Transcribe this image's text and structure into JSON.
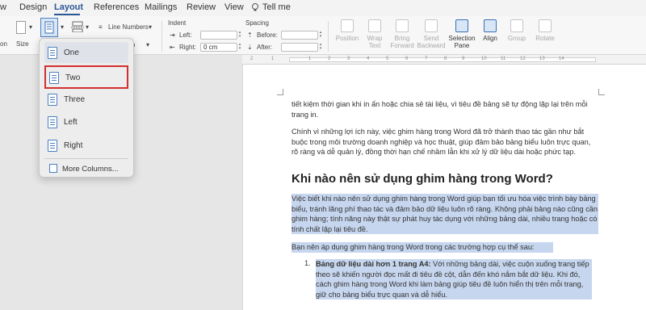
{
  "tabs": [
    {
      "label": "w",
      "active": false
    },
    {
      "label": "Design",
      "active": false
    },
    {
      "label": "Layout",
      "active": true
    },
    {
      "label": "References",
      "active": false
    },
    {
      "label": "Mailings",
      "active": false
    },
    {
      "label": "Review",
      "active": false
    },
    {
      "label": "View",
      "active": false
    }
  ],
  "tell_me": "Tell me",
  "ribbon": {
    "size_label": "Size",
    "on_label": "on",
    "line_numbers": "Line Numbers",
    "hyphenation": "ation",
    "indent": {
      "title": "Indent",
      "left_label": "Left:",
      "right_label": "Right:",
      "left_value": "",
      "right_value": "0 cm"
    },
    "spacing": {
      "title": "Spacing",
      "before_label": "Before:",
      "after_label": "After:",
      "before_value": "",
      "after_value": ""
    },
    "arrange": [
      {
        "label": "Position",
        "enabled": false
      },
      {
        "label": "Wrap\nText",
        "enabled": false
      },
      {
        "label": "Bring\nForward",
        "enabled": false
      },
      {
        "label": "Send\nBackward",
        "enabled": false
      },
      {
        "label": "Selection\nPane",
        "enabled": true
      },
      {
        "label": "Align",
        "enabled": true
      },
      {
        "label": "Group",
        "enabled": false
      },
      {
        "label": "Rotate",
        "enabled": false
      }
    ]
  },
  "ruler": {
    "ticks": [
      "2",
      "1",
      "1",
      "2",
      "3",
      "4",
      "5",
      "6",
      "7",
      "8",
      "9",
      "10",
      "11",
      "12",
      "13",
      "14"
    ]
  },
  "columns_menu": {
    "items": [
      "One",
      "Two",
      "Three",
      "Left",
      "Right"
    ],
    "more": "More Columns...",
    "highlighted": "Two"
  },
  "document": {
    "p1": "tiết kiệm thời gian khi in ấn hoặc chia sẻ tài liệu, vì tiêu đề bảng sẽ tự động lặp lại trên mỗi trang in.",
    "p2": "Chính vì những lợi ích này, việc ghim hàng trong Word đã trở thành thao tác gần như bắt buộc trong môi trường doanh nghiệp và học thuật, giúp đảm bảo bảng biểu luôn trực quan, rõ ràng và dễ quản lý, đồng thời hạn chế nhầm lẫn khi xử lý dữ liệu dài hoặc phức tạp.",
    "heading": "Khi nào nên sử dụng ghim hàng trong Word?",
    "p3": "Việc biết khi nào nên sử dụng ghim hàng trong Word giúp bạn tối ưu hóa việc trình bày bảng biểu, tránh lãng phí thao tác và đảm bảo dữ liệu luôn rõ ràng. Không phải bảng nào cũng cần ghim hàng; tính năng này thật sự phát huy tác dụng với những bảng dài, nhiều trang hoặc có tính chất lặp lại tiêu đề.",
    "p4": "Bạn nên áp dụng ghim hàng trong Word trong các trường hợp cụ thể sau:",
    "li_number": "1.",
    "li_bold": "Bảng dữ liệu dài hơn 1 trang A4:",
    "li_text": " Với những bảng dài, việc cuộn xuống trang tiếp theo sẽ khiến người đọc mất đi tiêu đề cột, dẫn đến khó nắm bắt dữ liệu. Khi đó, cách ghim hàng trong Word khi làm bảng giúp tiêu đề luôn hiển thị trên mỗi trang, giữ cho bảng biểu trực quan và dễ hiểu."
  }
}
